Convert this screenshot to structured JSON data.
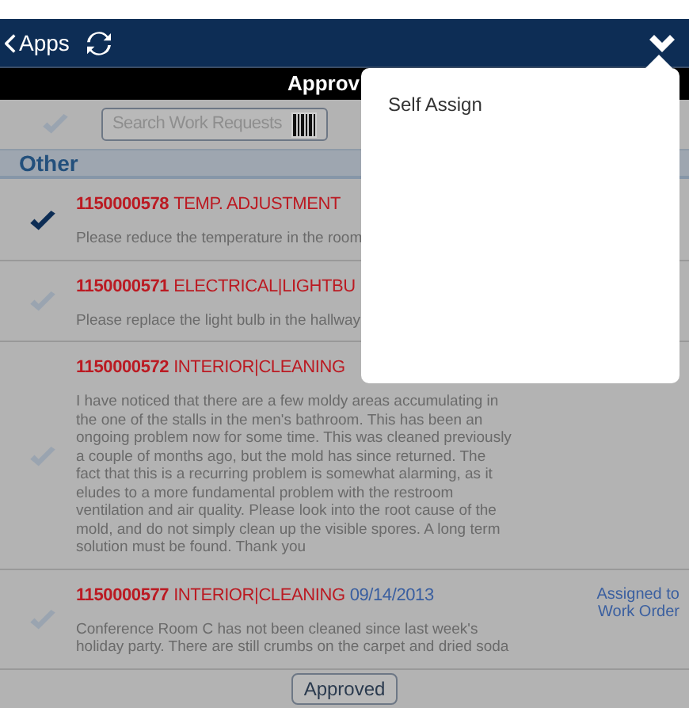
{
  "header": {
    "back_label": "Apps",
    "subtitle": "Approv"
  },
  "search": {
    "placeholder": "Search Work Requests"
  },
  "section": {
    "title": "Other"
  },
  "requests": [
    {
      "number": "1150000578",
      "category": "TEMP. ADJUSTMENT",
      "checked": true,
      "lines": [
        "Please reduce the temperature in the room"
      ]
    },
    {
      "number": "1150000571",
      "category": "ELECTRICAL|LIGHTBU",
      "checked": false,
      "lines": [
        "Please replace the light bulb in the hallway"
      ]
    },
    {
      "number": "1150000572",
      "category": "INTERIOR|CLEANING",
      "checked": false,
      "lines": [
        "I have noticed that there are a few moldy areas accumulating in",
        "the one of the stalls in the men's bathroom. This has been an",
        "ongoing problem now for some time. This was cleaned previously",
        "a couple of months ago, but the mold has since returned. The",
        "fact that this is a recurring problem is somewhat alarming, as it",
        "eludes to a more fundamental problem with the restroom",
        "ventilation and air quality. Please look into the root cause of the",
        "mold, and do not simply clean up the visible spores. A long term",
        "solution must be found. Thank you"
      ]
    },
    {
      "number": "1150000577",
      "category": "INTERIOR|CLEANING",
      "date": "09/14/2013",
      "status": "Assigned to Work Order",
      "checked": false,
      "lines": [
        "Conference Room C has not been cleaned since last week's",
        "holiday party. There are still crumbs on the carpet and dried soda"
      ]
    }
  ],
  "footer_button": "Approved",
  "menu": {
    "items": [
      "Self Assign"
    ]
  }
}
